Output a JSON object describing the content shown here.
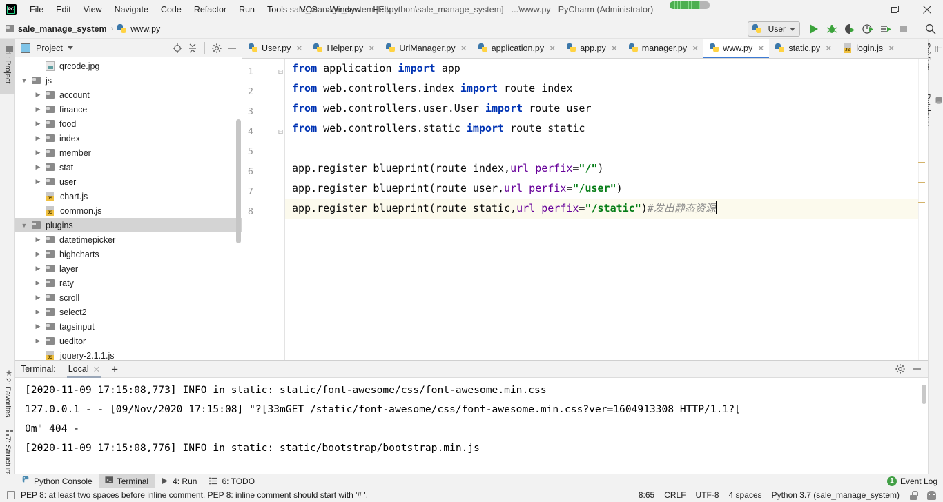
{
  "window": {
    "title": "sale_manage_system [E:\\python\\sale_manage_system] - ...\\www.py - PyCharm (Administrator)",
    "minimize": "—",
    "maximize": "❐",
    "close": "✕"
  },
  "menubar": {
    "items": [
      {
        "label": "File"
      },
      {
        "label": "Edit"
      },
      {
        "label": "View"
      },
      {
        "label": "Navigate"
      },
      {
        "label": "Code"
      },
      {
        "label": "Refactor"
      },
      {
        "label": "Run"
      },
      {
        "label": "Tools"
      },
      {
        "label": "VCS"
      },
      {
        "label": "Window"
      },
      {
        "label": "Help"
      }
    ]
  },
  "breadcrumb": {
    "project": "sale_manage_system",
    "separator": "›",
    "file": "www.py"
  },
  "toolbar": {
    "run_config": "User",
    "icons": [
      "run-icon",
      "debug-icon",
      "coverage-icon",
      "profile-icon",
      "attach-icon",
      "stop-icon",
      "search-everywhere-icon"
    ]
  },
  "left_strip": {
    "top": [
      {
        "label": "1: Project",
        "active": true
      }
    ],
    "bottom": [
      {
        "label": "2: Favorites"
      },
      {
        "label": "7: Structure"
      }
    ]
  },
  "right_strip": {
    "items": [
      {
        "label": "SciView"
      },
      {
        "label": "Database"
      }
    ]
  },
  "project_panel": {
    "title": "Project",
    "tree": [
      {
        "label": "qrcode.jpg",
        "indent": 4,
        "arrow": "none",
        "icon": "image",
        "selected": false
      },
      {
        "label": "js",
        "indent": 3,
        "arrow": "down",
        "icon": "folder",
        "selected": false
      },
      {
        "label": "account",
        "indent": 4,
        "arrow": "right",
        "icon": "folder",
        "selected": false
      },
      {
        "label": "finance",
        "indent": 4,
        "arrow": "right",
        "icon": "folder",
        "selected": false
      },
      {
        "label": "food",
        "indent": 4,
        "arrow": "right",
        "icon": "folder",
        "selected": false
      },
      {
        "label": "index",
        "indent": 4,
        "arrow": "right",
        "icon": "folder",
        "selected": false
      },
      {
        "label": "member",
        "indent": 4,
        "arrow": "right",
        "icon": "folder",
        "selected": false
      },
      {
        "label": "stat",
        "indent": 4,
        "arrow": "right",
        "icon": "folder",
        "selected": false
      },
      {
        "label": "user",
        "indent": 4,
        "arrow": "right",
        "icon": "folder",
        "selected": false
      },
      {
        "label": "chart.js",
        "indent": 4,
        "arrow": "none",
        "icon": "js",
        "selected": false
      },
      {
        "label": "common.js",
        "indent": 4,
        "arrow": "none",
        "icon": "js",
        "selected": false
      },
      {
        "label": "plugins",
        "indent": 3,
        "arrow": "down",
        "icon": "folder",
        "selected": true
      },
      {
        "label": "datetimepicker",
        "indent": 4,
        "arrow": "right",
        "icon": "folder",
        "selected": false
      },
      {
        "label": "highcharts",
        "indent": 4,
        "arrow": "right",
        "icon": "folder",
        "selected": false
      },
      {
        "label": "layer",
        "indent": 4,
        "arrow": "right",
        "icon": "folder",
        "selected": false
      },
      {
        "label": "raty",
        "indent": 4,
        "arrow": "right",
        "icon": "folder",
        "selected": false
      },
      {
        "label": "scroll",
        "indent": 4,
        "arrow": "right",
        "icon": "folder",
        "selected": false
      },
      {
        "label": "select2",
        "indent": 4,
        "arrow": "right",
        "icon": "folder",
        "selected": false
      },
      {
        "label": "tagsinput",
        "indent": 4,
        "arrow": "right",
        "icon": "folder",
        "selected": false
      },
      {
        "label": "ueditor",
        "indent": 4,
        "arrow": "right",
        "icon": "folder",
        "selected": false
      },
      {
        "label": "jquery-2.1.1.js",
        "indent": 4,
        "arrow": "none",
        "icon": "js",
        "selected": false
      }
    ]
  },
  "editor_tabs": [
    {
      "label": "User.py",
      "icon": "py",
      "active": false
    },
    {
      "label": "Helper.py",
      "icon": "py",
      "active": false
    },
    {
      "label": "UrlManager.py",
      "icon": "py",
      "active": false
    },
    {
      "label": "application.py",
      "icon": "py",
      "active": false
    },
    {
      "label": "app.py",
      "icon": "py",
      "active": false
    },
    {
      "label": "manager.py",
      "icon": "py",
      "active": false
    },
    {
      "label": "www.py",
      "icon": "py",
      "active": true
    },
    {
      "label": "static.py",
      "icon": "py",
      "active": false
    },
    {
      "label": "login.js",
      "icon": "js",
      "active": false
    }
  ],
  "code": {
    "lines": [
      {
        "num": "1",
        "fold": "minus",
        "current": false,
        "tokens": [
          {
            "t": "from ",
            "c": "kw"
          },
          {
            "t": "application ",
            "c": ""
          },
          {
            "t": "import ",
            "c": "kw"
          },
          {
            "t": "app",
            "c": ""
          }
        ]
      },
      {
        "num": "2",
        "fold": "",
        "current": false,
        "tokens": [
          {
            "t": "from ",
            "c": "kw"
          },
          {
            "t": "web.controllers.index ",
            "c": ""
          },
          {
            "t": "import ",
            "c": "kw"
          },
          {
            "t": "route_index",
            "c": ""
          }
        ]
      },
      {
        "num": "3",
        "fold": "",
        "current": false,
        "tokens": [
          {
            "t": "from ",
            "c": "kw"
          },
          {
            "t": "web.controllers.user.User ",
            "c": ""
          },
          {
            "t": "import ",
            "c": "kw"
          },
          {
            "t": "route_user",
            "c": ""
          }
        ]
      },
      {
        "num": "4",
        "fold": "minus",
        "current": false,
        "tokens": [
          {
            "t": "from ",
            "c": "kw"
          },
          {
            "t": "web.controllers.static ",
            "c": ""
          },
          {
            "t": "import ",
            "c": "kw"
          },
          {
            "t": "route_static",
            "c": ""
          }
        ]
      },
      {
        "num": "5",
        "fold": "",
        "current": false,
        "tokens": []
      },
      {
        "num": "6",
        "fold": "",
        "current": false,
        "tokens": [
          {
            "t": "app.register_blueprint(route_index,",
            "c": ""
          },
          {
            "t": "url_perfix",
            "c": "kwarg"
          },
          {
            "t": "=",
            "c": ""
          },
          {
            "t": "\"/\"",
            "c": "str"
          },
          {
            "t": ")",
            "c": ""
          }
        ]
      },
      {
        "num": "7",
        "fold": "",
        "current": false,
        "tokens": [
          {
            "t": "app.register_blueprint(route_user,",
            "c": ""
          },
          {
            "t": "url_perfix",
            "c": "kwarg"
          },
          {
            "t": "=",
            "c": ""
          },
          {
            "t": "\"/user\"",
            "c": "str"
          },
          {
            "t": ")",
            "c": ""
          }
        ]
      },
      {
        "num": "8",
        "fold": "",
        "current": true,
        "tokens": [
          {
            "t": "app.register_blueprint(route_static,",
            "c": ""
          },
          {
            "t": "url_perfix",
            "c": "kwarg"
          },
          {
            "t": "=",
            "c": ""
          },
          {
            "t": "\"/static\"",
            "c": "str"
          },
          {
            "t": ")",
            "c": ""
          },
          {
            "t": "#发出静态资源",
            "c": "cmt"
          }
        ]
      }
    ]
  },
  "terminal": {
    "label": "Terminal:",
    "tab": "Local",
    "add": "+",
    "lines": [
      "[2020-11-09 17:15:08,773] INFO in static: static/font-awesome/css/font-awesome.min.css",
      "127.0.0.1 - - [09/Nov/2020 17:15:08] \"?[33mGET /static/font-awesome/css/font-awesome.min.css?ver=1604913308 HTTP/1.1?[",
      "0m\" 404 -",
      "[2020-11-09 17:15:08,776] INFO in static: static/bootstrap/bootstrap.min.js"
    ]
  },
  "bottom_bar": {
    "items": [
      {
        "label": "Python Console",
        "icon": "python-console-icon",
        "active": false
      },
      {
        "label": "Terminal",
        "icon": "terminal-icon",
        "active": true
      },
      {
        "label": "4: Run",
        "icon": "run-icon",
        "active": false
      },
      {
        "label": "6: TODO",
        "icon": "todo-icon",
        "active": false
      }
    ],
    "event_log": {
      "count": "1",
      "label": "Event Log"
    }
  },
  "status_bar": {
    "message": "PEP 8: at least two spaces before inline comment. PEP 8: inline comment should start with '# '.",
    "caret": "8:65",
    "line_sep": "CRLF",
    "encoding": "UTF-8",
    "indent": "4 spaces",
    "interpreter": "Python 3.7 (sale_manage_system)"
  },
  "colors": {
    "accent": "#3d7bd4",
    "keyword": "#0033b3",
    "string": "#067d17",
    "kwarg": "#660099",
    "comment": "#8c8c8c",
    "selection": "#d4d4d4",
    "current_line": "#fcfaed"
  }
}
